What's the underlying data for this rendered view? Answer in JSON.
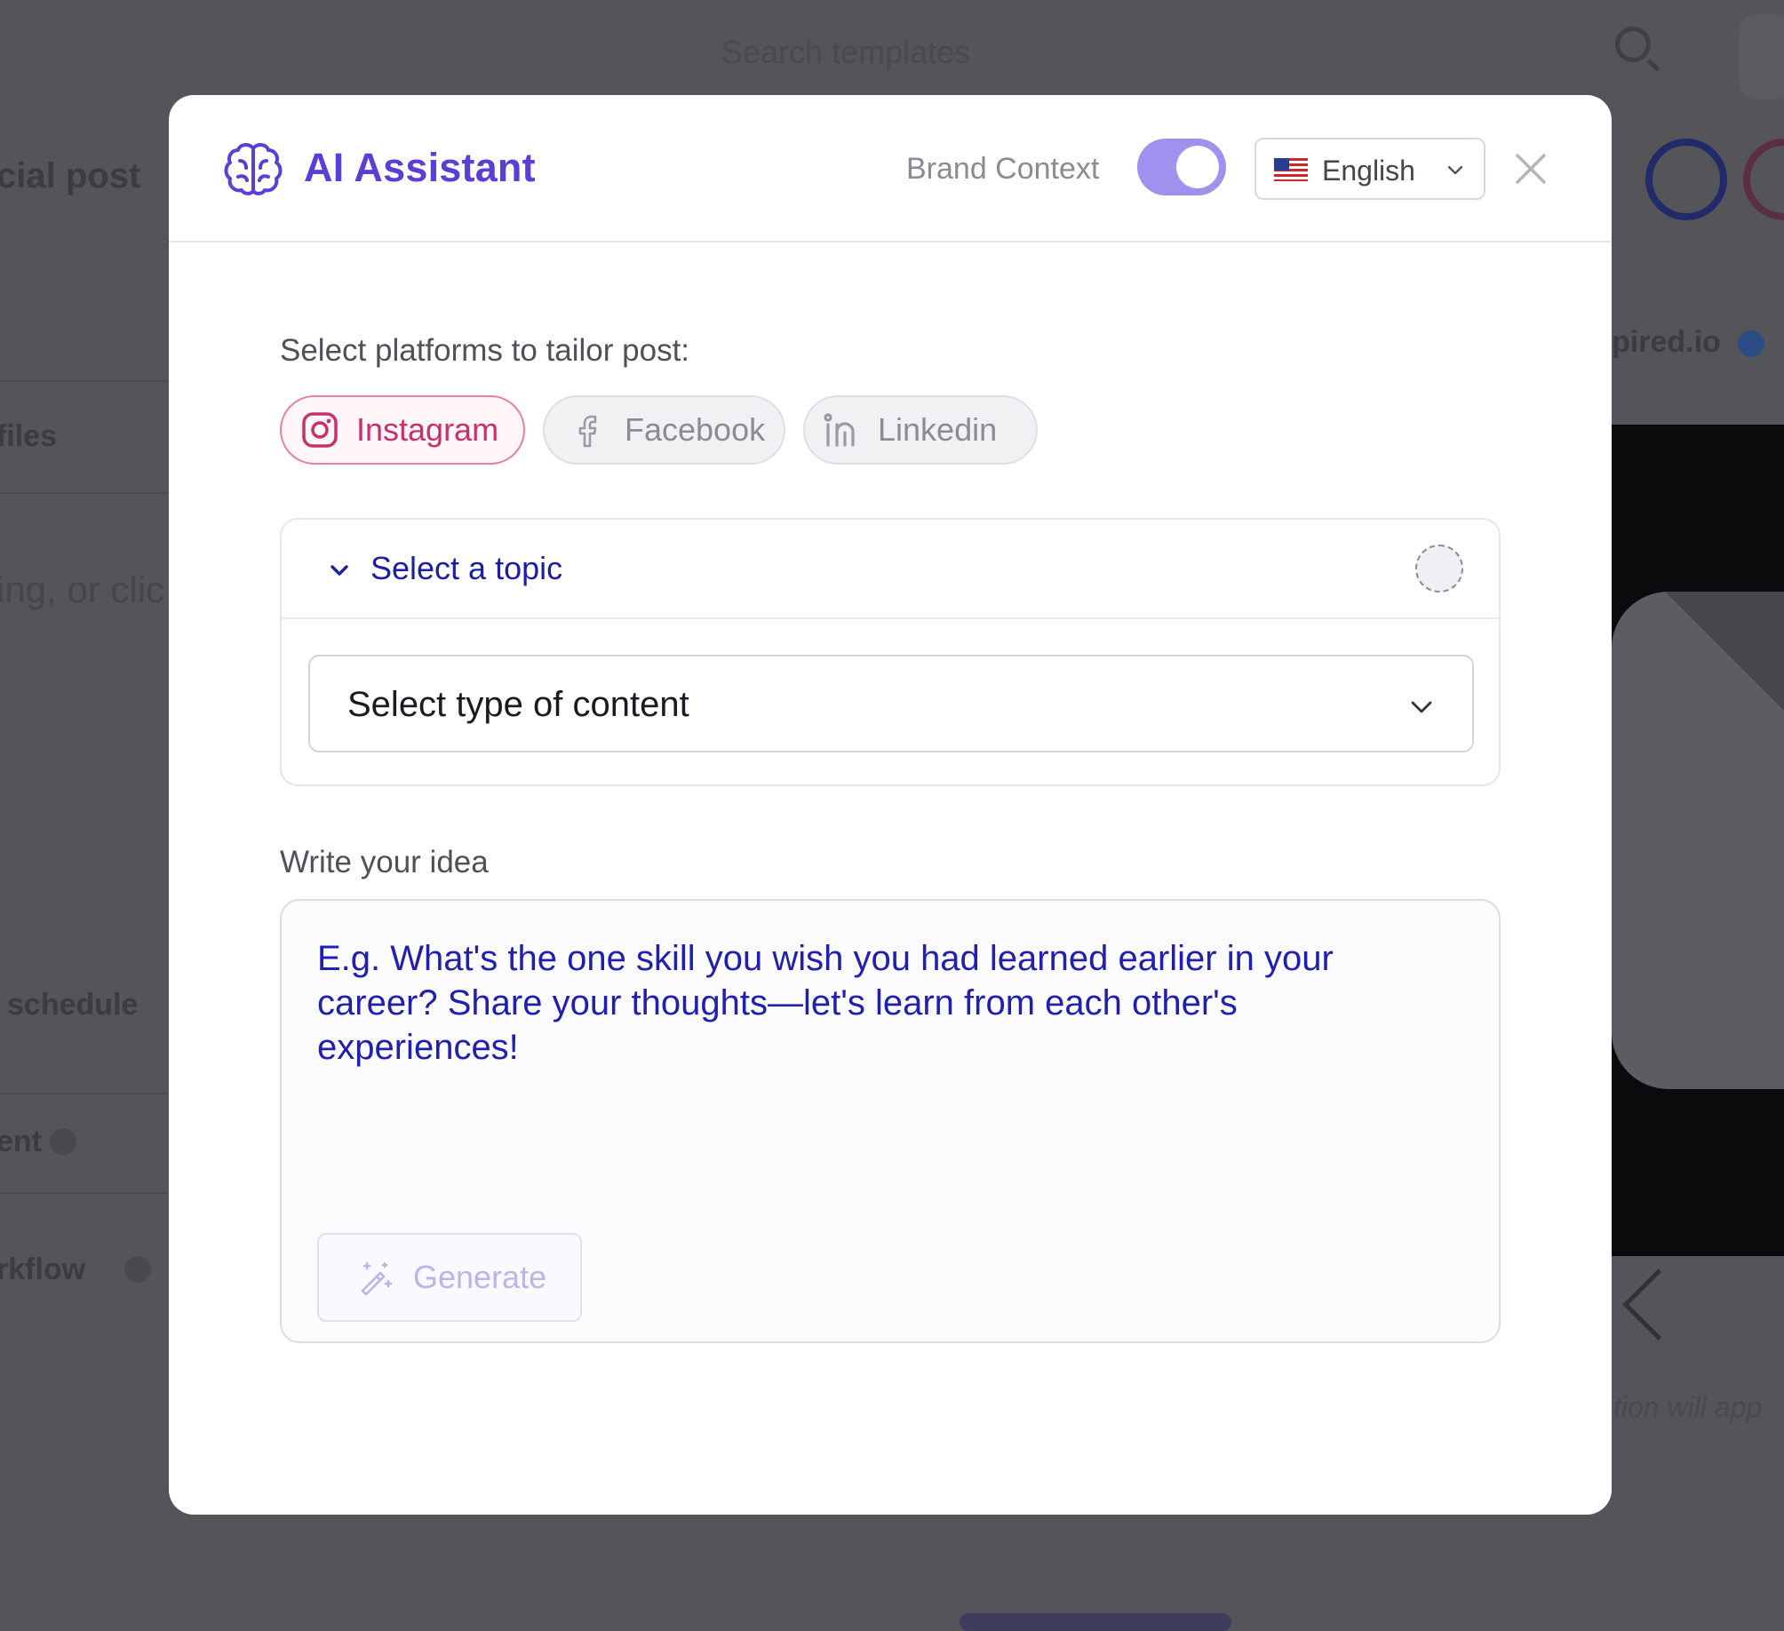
{
  "background": {
    "search_placeholder": "Search templates",
    "post_label": "cial post",
    "profiles_label": "files",
    "editor_hint": "ing, or clic",
    "schedule_label": "schedule",
    "ent_label": "ent",
    "workflow_label": "rkflow",
    "preview_account": "pired.io",
    "preview_hint": "tion will app"
  },
  "modal": {
    "title": "AI Assistant",
    "brand_context_label": "Brand Context",
    "brand_context_on": true,
    "language": {
      "flag": "us-flag",
      "label": "English"
    },
    "platforms_label": "Select platforms to tailor post:",
    "platforms": [
      {
        "label": "Instagram",
        "selected": true,
        "icon": "instagram-icon"
      },
      {
        "label": "Facebook",
        "selected": false,
        "icon": "facebook-icon"
      },
      {
        "label": "Linkedin",
        "selected": false,
        "icon": "linkedin-icon"
      }
    ],
    "topic_label": "Select a topic",
    "content_type_placeholder": "Select type of content",
    "idea_label": "Write your idea",
    "idea_placeholder": "E.g. What's the one skill you wish you had learned earlier in your career? Share your thoughts—let's learn from each other's experiences!",
    "generate_label": "Generate"
  },
  "colors": {
    "accent": "#5a3fd6",
    "toggle": "#9f92ef",
    "instagram": "#c8306a",
    "link_blue": "#1a1fa6"
  }
}
